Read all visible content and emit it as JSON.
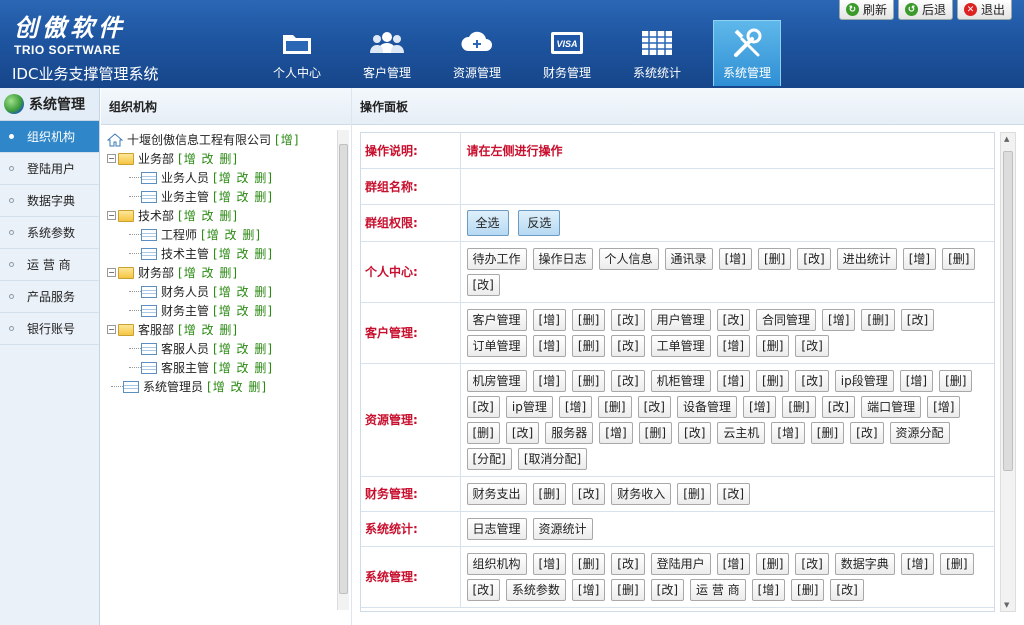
{
  "header": {
    "brand_cn": "创傲软件",
    "brand_en": "TRIO SOFTWARE",
    "system_name": "IDC业务支撑管理系统",
    "nav": [
      {
        "label": "个人中心",
        "icon": "folder-icon"
      },
      {
        "label": "客户管理",
        "icon": "users-icon"
      },
      {
        "label": "资源管理",
        "icon": "cloud-icon"
      },
      {
        "label": "财务管理",
        "icon": "visa-card-icon"
      },
      {
        "label": "系统统计",
        "icon": "grid-table-icon"
      },
      {
        "label": "系统管理",
        "icon": "tools-icon",
        "active": true
      }
    ],
    "top_buttons": [
      {
        "label": "刷新",
        "icon": "refresh-icon",
        "color": "#3a9a2a"
      },
      {
        "label": "后退",
        "icon": "back-icon",
        "color": "#3a9a2a"
      },
      {
        "label": "退出",
        "icon": "exit-icon",
        "color": "#d22"
      }
    ]
  },
  "sidebar": {
    "title": "系统管理",
    "items": [
      "组织机构",
      "登陆用户",
      "数据字典",
      "系统参数",
      "运 营 商",
      "产品服务",
      "银行账号"
    ],
    "active_index": 0
  },
  "tree_panel": {
    "title": "组织机构",
    "root": {
      "label": "十堰创傲信息工程有限公司",
      "ops": "[增]"
    },
    "groups": [
      {
        "label": "业务部",
        "ops": "[增 改 删]",
        "children": [
          {
            "label": "业务人员",
            "ops": "[增 改 删]"
          },
          {
            "label": "业务主管",
            "ops": "[增 改 删]"
          }
        ]
      },
      {
        "label": "技术部",
        "ops": "[增 改 删]",
        "children": [
          {
            "label": "工程师",
            "ops": "[增 改 删]"
          },
          {
            "label": "技术主管",
            "ops": "[增 改 删]"
          }
        ]
      },
      {
        "label": "财务部",
        "ops": "[增 改 删]",
        "children": [
          {
            "label": "财务人员",
            "ops": "[增 改 删]"
          },
          {
            "label": "财务主管",
            "ops": "[增 改 删]"
          }
        ]
      },
      {
        "label": "客服部",
        "ops": "[增 改 删]",
        "children": [
          {
            "label": "客服人员",
            "ops": "[增 改 删]"
          },
          {
            "label": "客服主管",
            "ops": "[增 改 删]"
          }
        ]
      }
    ],
    "admin": {
      "label": "系统管理员",
      "ops": "[增 改 删]"
    }
  },
  "main_panel": {
    "title": "操作面板",
    "instruction_label": "操作说明:",
    "instruction_text": "请在左侧进行操作",
    "group_name_label": "群组名称:",
    "group_perm_label": "群组权限:",
    "select_all": "全选",
    "invert": "反选",
    "sections": [
      {
        "label": "个人中心:",
        "perms": [
          "待办工作",
          "操作日志",
          "个人信息",
          "通讯录",
          "[增]",
          "[删]",
          "[改]",
          "进出统计",
          "[增]",
          "[删]",
          "[改]"
        ]
      },
      {
        "label": "客户管理:",
        "perms": [
          "客户管理",
          "[增]",
          "[删]",
          "[改]",
          "用户管理",
          "[改]",
          "合同管理",
          "[增]",
          "[删]",
          "[改]",
          "订单管理",
          "[增]",
          "[删]",
          "[改]",
          "工单管理",
          "[增]",
          "[删]",
          "[改]"
        ]
      },
      {
        "label": "资源管理:",
        "perms": [
          "机房管理",
          "[增]",
          "[删]",
          "[改]",
          "机柜管理",
          "[增]",
          "[删]",
          "[改]",
          "ip段管理",
          "[增]",
          "[删]",
          "[改]",
          "ip管理",
          "[增]",
          "[删]",
          "[改]",
          "设备管理",
          "[增]",
          "[删]",
          "[改]",
          "端口管理",
          "[增]",
          "[删]",
          "[改]",
          "服务器",
          "[增]",
          "[删]",
          "[改]",
          "云主机",
          "[增]",
          "[删]",
          "[改]",
          "资源分配",
          "[分配]",
          "[取消分配]"
        ]
      },
      {
        "label": "财务管理:",
        "perms": [
          "财务支出",
          "[删]",
          "[改]",
          "财务收入",
          "[删]",
          "[改]"
        ]
      },
      {
        "label": "系统统计:",
        "perms": [
          "日志管理",
          "资源统计"
        ]
      },
      {
        "label": "系统管理:",
        "perms": [
          "组织机构",
          "[增]",
          "[删]",
          "[改]",
          "登陆用户",
          "[增]",
          "[删]",
          "[改]",
          "数据字典",
          "[增]",
          "[删]",
          "[改]",
          "系统参数",
          "[增]",
          "[删]",
          "[改]",
          "运 营 商",
          "[增]",
          "[删]",
          "[改]"
        ]
      }
    ]
  }
}
